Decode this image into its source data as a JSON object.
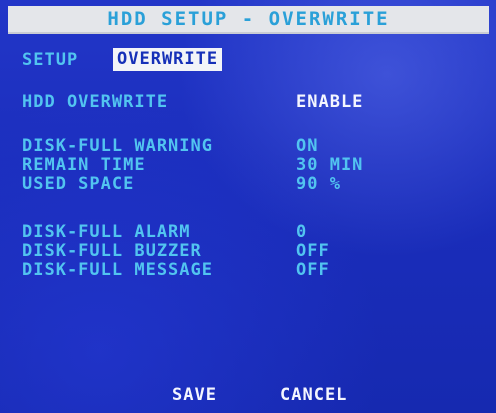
{
  "title": "HDD SETUP - OVERWRITE",
  "menu": {
    "label": "SETUP",
    "active_tab": "OVERWRITE"
  },
  "settings": {
    "hdd_overwrite": {
      "label": "HDD OVERWRITE",
      "value": "ENABLE"
    },
    "disk_full_warning": {
      "label": "DISK-FULL WARNING",
      "value": "ON"
    },
    "remain_time": {
      "label": "REMAIN TIME",
      "value": "30 MIN"
    },
    "used_space": {
      "label": "USED SPACE",
      "value": "90 %"
    },
    "disk_full_alarm": {
      "label": "DISK-FULL ALARM",
      "value": "0"
    },
    "disk_full_buzzer": {
      "label": "DISK-FULL BUZZER",
      "value": "OFF"
    },
    "disk_full_message": {
      "label": "DISK-FULL MESSAGE",
      "value": "OFF"
    }
  },
  "buttons": {
    "save": "SAVE",
    "cancel": "CANCEL"
  },
  "colors": {
    "background": "#1b2ebd",
    "text": "#52c4f0",
    "highlight_text": "#f4f6ff",
    "title_bar": "#e4e6ea",
    "title_text": "#2aa0d8"
  }
}
